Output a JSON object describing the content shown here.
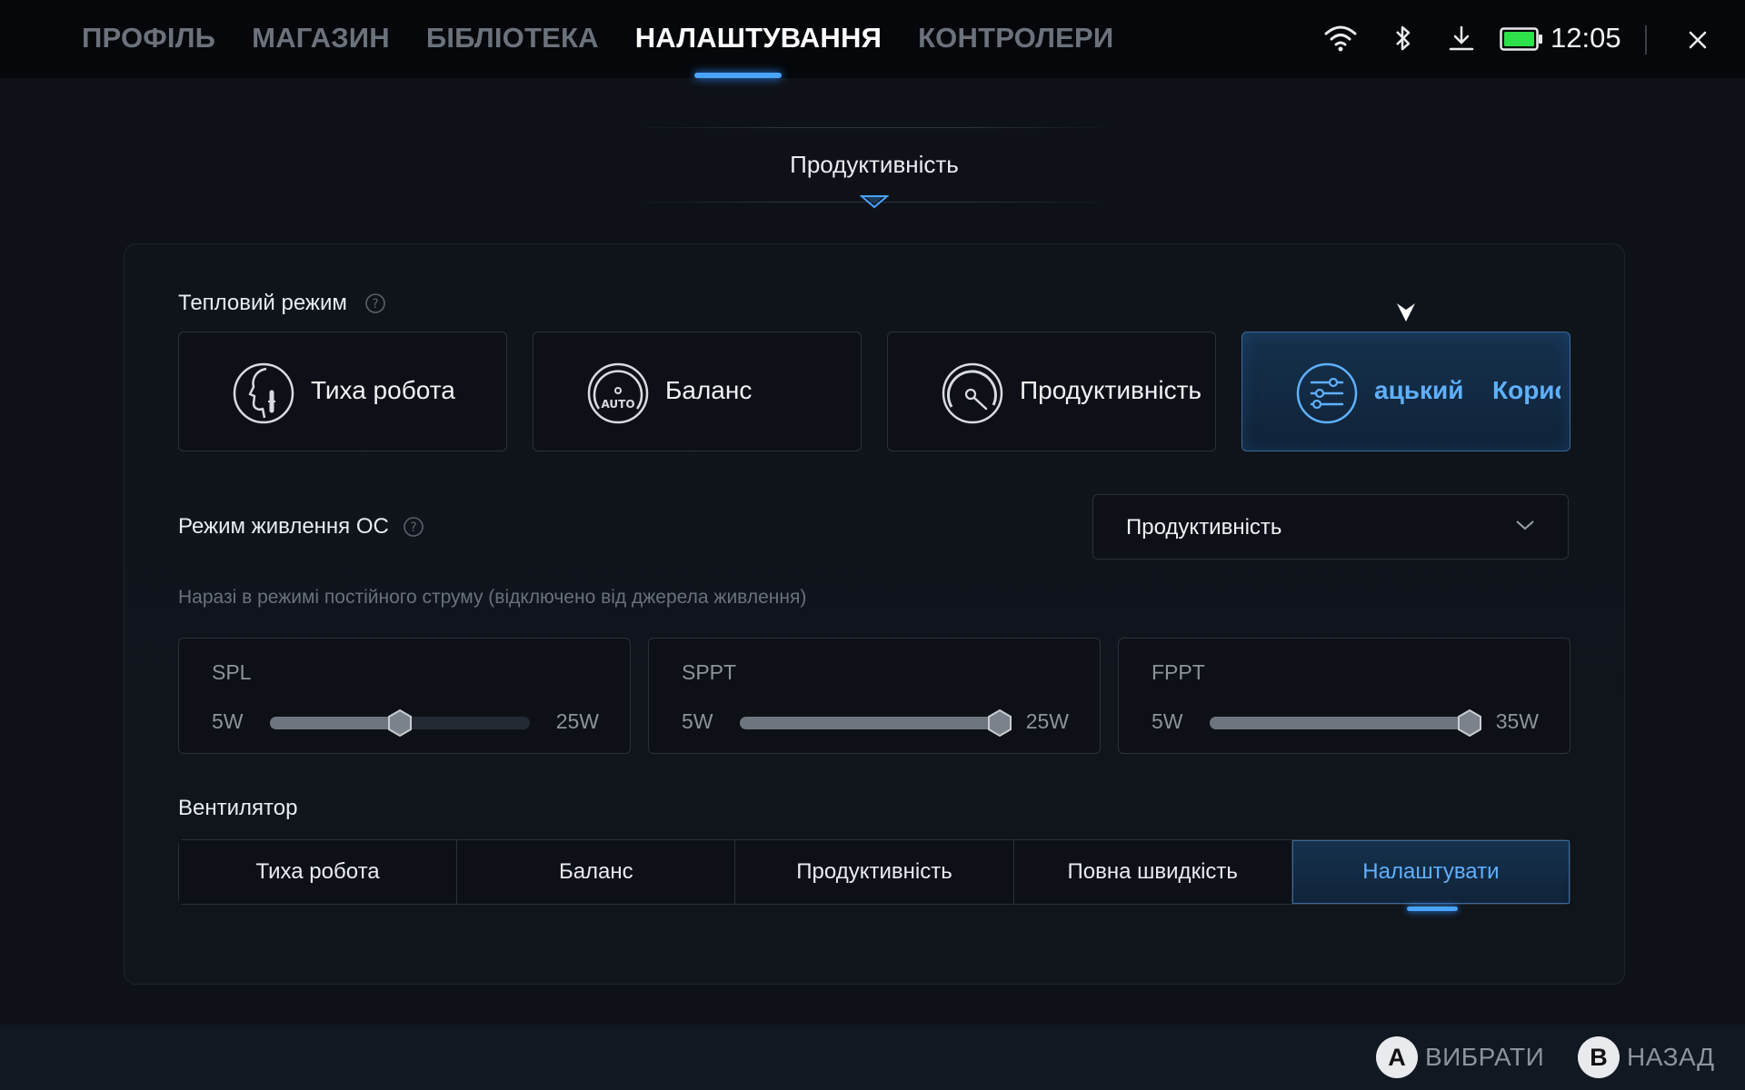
{
  "nav": {
    "tabs": [
      {
        "label": "ПРОФІЛЬ"
      },
      {
        "label": "МАГАЗИН"
      },
      {
        "label": "БІБЛІОТЕКА"
      },
      {
        "label": "НАЛАШТУВАННЯ"
      },
      {
        "label": "КОНТРОЛЕРИ"
      }
    ],
    "active_tab": "НАЛАШТУВАННЯ"
  },
  "status": {
    "clock": "12:05",
    "icons": [
      "wifi-icon",
      "bluetooth-icon",
      "download-icon",
      "battery-icon",
      "close-icon"
    ],
    "battery_color": "#2ee04a"
  },
  "section": {
    "title": "Продуктивність"
  },
  "thermal": {
    "label": "Тепловий режим",
    "modes": [
      {
        "label": "Тиха робота",
        "icon": "silent-face-icon"
      },
      {
        "label": "Баланс",
        "icon": "auto-gauge-icon"
      },
      {
        "label": "Продуктивність",
        "icon": "performance-gauge-icon"
      },
      {
        "label_left": "ацький",
        "label_right": "Корис",
        "icon": "sliders-icon",
        "selected": true
      }
    ]
  },
  "os_power": {
    "label": "Режим живлення ОС",
    "value": "Продуктивність"
  },
  "hint": "Наразі в режимі постійного струму (відключено від джерела живлення)",
  "sliders": [
    {
      "name": "SPL",
      "min": "5W",
      "max": "25W",
      "min_value": 5,
      "max_value": 25,
      "value": 15
    },
    {
      "name": "SPPT",
      "min": "5W",
      "max": "25W",
      "min_value": 5,
      "max_value": 25,
      "value": 25
    },
    {
      "name": "FPPT",
      "min": "5W",
      "max": "35W",
      "min_value": 5,
      "max_value": 35,
      "value": 35
    }
  ],
  "fan": {
    "label": "Вентилятор",
    "options": [
      {
        "label": "Тиха робота"
      },
      {
        "label": "Баланс"
      },
      {
        "label": "Продуктивність"
      },
      {
        "label": "Повна швидкість"
      },
      {
        "label": "Налаштувати",
        "active": true
      }
    ]
  },
  "bottom": {
    "select": {
      "key": "A",
      "label": "ВИБРАТИ"
    },
    "back": {
      "key": "B",
      "label": "НАЗАД"
    }
  },
  "colors": {
    "accent": "#4aa3ff",
    "accent_text": "#5fb0ff"
  }
}
